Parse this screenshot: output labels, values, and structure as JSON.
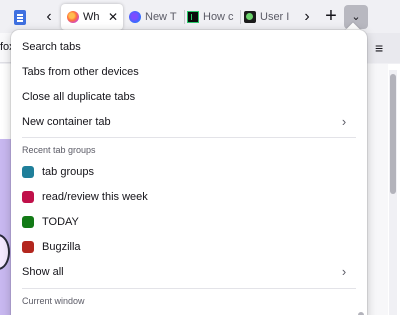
{
  "tabstrip": {
    "tabs": [
      {
        "title": "Wh",
        "favicon": "firefox-icon",
        "active": true
      },
      {
        "title": "New T",
        "favicon": "firefox-nightly-icon",
        "active": false
      },
      {
        "title": "How c",
        "favicon": "terminal-icon",
        "active": false
      },
      {
        "title": "User I",
        "favicon": "bug-icon",
        "active": false
      }
    ],
    "icons": {
      "tab_groups": "tab-groups-icon",
      "scroll_left": "chevron-left-icon",
      "scroll_right": "chevron-right-icon",
      "new_tab": "plus-icon",
      "list_all_tabs": "chevron-down-icon"
    },
    "glyphs": {
      "left": "‹",
      "right": "›",
      "plus": "+",
      "down": "⌄",
      "close": "✕"
    }
  },
  "navbar": {
    "url_fragment": "fox",
    "menu_glyph": "≡"
  },
  "menu": {
    "items": [
      {
        "label": "Search tabs"
      },
      {
        "label": "Tabs from other devices"
      },
      {
        "label": "Close all duplicate tabs"
      },
      {
        "label": "New container tab",
        "has_submenu": true
      }
    ],
    "recent_groups_header": "Recent tab groups",
    "groups": [
      {
        "label": "tab groups",
        "color": "#1f7f9a"
      },
      {
        "label": "read/review this week",
        "color": "#c0104a"
      },
      {
        "label": "TODAY",
        "color": "#127a16"
      },
      {
        "label": "Bugzilla",
        "color": "#b3261e"
      }
    ],
    "show_all": "Show all",
    "current_window_header": "Current window",
    "chevron_glyph": "›"
  },
  "colors": {
    "accent_active_button": "#b8b8c0",
    "panel_background": "#ffffff",
    "toolbar_background": "#f0f0f4"
  }
}
